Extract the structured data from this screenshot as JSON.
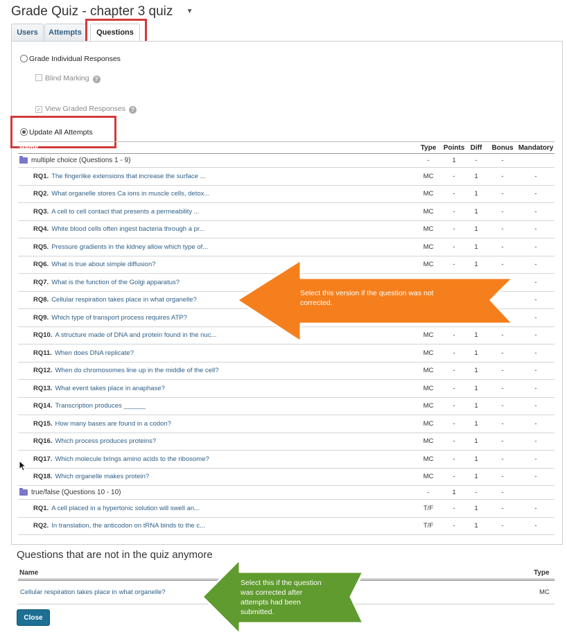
{
  "page": {
    "title": "Grade Quiz - chapter 3 quiz",
    "title_caret": "▼"
  },
  "tabs": [
    {
      "label": "Users"
    },
    {
      "label": "Attempts"
    },
    {
      "label": "Questions"
    }
  ],
  "options": {
    "grade_individual": "Grade Individual Responses",
    "blind_marking": "Blind Marking",
    "view_graded": "View Graded Responses",
    "update_all": "Update All Attempts",
    "help_glyph": "?"
  },
  "table": {
    "headers": {
      "name": "Name",
      "type": "Type",
      "points": "Points",
      "diff": "Diff",
      "bonus": "Bonus",
      "mandatory": "Mandatory"
    },
    "sections": [
      {
        "label": "multiple choice (Questions 1 - 9)",
        "type": "-",
        "points": "1",
        "diff": "-",
        "bonus": "-",
        "mandatory": "",
        "rows": [
          {
            "num": "RQ1.",
            "text": "The fingerlike extensions that increase the surface ...",
            "type": "MC",
            "points": "-",
            "diff": "1",
            "bonus": "-",
            "mandatory": "-"
          },
          {
            "num": "RQ2.",
            "text": "What organelle stores Ca ions in muscle cells, detox...",
            "type": "MC",
            "points": "-",
            "diff": "1",
            "bonus": "-",
            "mandatory": "-"
          },
          {
            "num": "RQ3.",
            "text": "A cell to cell contact that presents a permeability ...",
            "type": "MC",
            "points": "-",
            "diff": "1",
            "bonus": "-",
            "mandatory": "-"
          },
          {
            "num": "RQ4.",
            "text": "White blood cells often ingest bacteria through a pr...",
            "type": "MC",
            "points": "-",
            "diff": "1",
            "bonus": "-",
            "mandatory": "-"
          },
          {
            "num": "RQ5.",
            "text": "Pressure gradients in the kidney allow which type of...",
            "type": "MC",
            "points": "-",
            "diff": "1",
            "bonus": "-",
            "mandatory": "-"
          },
          {
            "num": "RQ6.",
            "text": "What is true about simple diffusion?",
            "type": "MC",
            "points": "-",
            "diff": "1",
            "bonus": "-",
            "mandatory": "-"
          },
          {
            "num": "RQ7.",
            "text": "What is the function of the Golgi apparatus?",
            "type": "",
            "points": "",
            "diff": "",
            "bonus": "",
            "mandatory": "-"
          },
          {
            "num": "RQ8.",
            "text": "Cellular respiration takes place in what organelle?",
            "type": "",
            "points": "",
            "diff": "",
            "bonus": "",
            "mandatory": "-"
          },
          {
            "num": "RQ9.",
            "text": "Which type of transport process requires ATP?",
            "type": "",
            "points": "",
            "diff": "",
            "bonus": "",
            "mandatory": "-"
          },
          {
            "num": "RQ10.",
            "text": "A structure made of DNA and protein found in the nuc...",
            "type": "MC",
            "points": "-",
            "diff": "1",
            "bonus": "-",
            "mandatory": "-"
          },
          {
            "num": "RQ11.",
            "text": "When does DNA replicate?",
            "type": "MC",
            "points": "-",
            "diff": "1",
            "bonus": "-",
            "mandatory": "-"
          },
          {
            "num": "RQ12.",
            "text": "When do chromosomes line up in the middle of the cell?",
            "type": "MC",
            "points": "-",
            "diff": "1",
            "bonus": "-",
            "mandatory": "-"
          },
          {
            "num": "RQ13.",
            "text": "What event takes place in anaphase?",
            "type": "MC",
            "points": "-",
            "diff": "1",
            "bonus": "-",
            "mandatory": "-"
          },
          {
            "num": "RQ14.",
            "text": "Transcription produces ______",
            "type": "MC",
            "points": "-",
            "diff": "1",
            "bonus": "-",
            "mandatory": "-"
          },
          {
            "num": "RQ15.",
            "text": "How many bases are found in a codon?",
            "type": "MC",
            "points": "-",
            "diff": "1",
            "bonus": "-",
            "mandatory": "-"
          },
          {
            "num": "RQ16.",
            "text": "Which process produces proteins?",
            "type": "MC",
            "points": "-",
            "diff": "1",
            "bonus": "-",
            "mandatory": "-"
          },
          {
            "num": "RQ17.",
            "text": "Which molecule brings amino acids to the ribosome?",
            "type": "MC",
            "points": "-",
            "diff": "1",
            "bonus": "-",
            "mandatory": "-"
          },
          {
            "num": "RQ18.",
            "text": "Which organelle makes protein?",
            "type": "MC",
            "points": "-",
            "diff": "1",
            "bonus": "-",
            "mandatory": "-"
          }
        ]
      },
      {
        "label": "true/false (Questions 10 - 10)",
        "type": "-",
        "points": "1",
        "diff": "-",
        "bonus": "-",
        "mandatory": "",
        "rows": [
          {
            "num": "RQ1.",
            "text": "A cell placed in a hypertonic solution will swell an...",
            "type": "T/F",
            "points": "-",
            "diff": "1",
            "bonus": "-",
            "mandatory": "-"
          },
          {
            "num": "RQ2.",
            "text": "In translation, the anticodon on tRNA binds to the c...",
            "type": "T/F",
            "points": "-",
            "diff": "1",
            "bonus": "-",
            "mandatory": "-"
          }
        ]
      }
    ]
  },
  "removed": {
    "title": "Questions that are not in the quiz anymore",
    "headers": {
      "name": "Name",
      "type": "Type"
    },
    "rows": [
      {
        "name": "Cellular respiration takes place in what organelle?",
        "type": "MC"
      }
    ]
  },
  "buttons": {
    "close": "Close"
  },
  "callouts": {
    "orange": "Select this version if the question was not corrected.",
    "green": "Select this if the question was corrected after attempts had been submitted."
  },
  "colors": {
    "link": "#2f5f85",
    "highlight": "#d03b3b",
    "orange_callout": "#f57f1c",
    "green_callout": "#5f9b2e",
    "button": "#1d6f93"
  }
}
